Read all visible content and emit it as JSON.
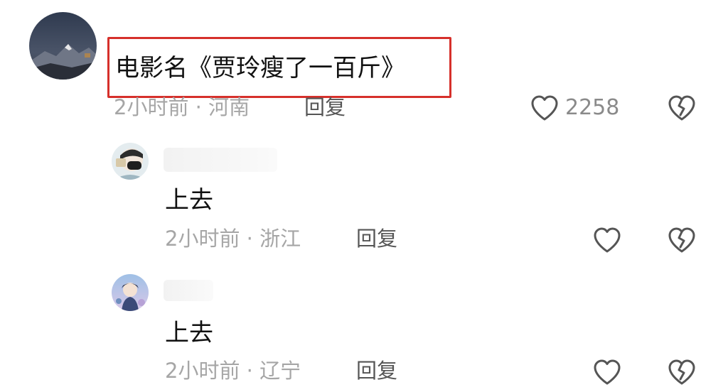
{
  "main_comment": {
    "text": "电影名《贾玲瘦了一百斤》",
    "time": "2小时前",
    "location": "河南",
    "separator": "·",
    "reply_label": "回复",
    "like_count": "2258",
    "highlight_color": "#d6302b"
  },
  "replies": [
    {
      "text": "上去",
      "time": "2小时前",
      "location": "浙江",
      "separator": "·",
      "reply_label": "回复"
    },
    {
      "text": "上去",
      "time": "2小时前",
      "location": "辽宁",
      "separator": "·",
      "reply_label": "回复"
    }
  ],
  "icons": {
    "like": "heart-outline-icon",
    "dislike": "broken-heart-icon"
  },
  "colors": {
    "text": "#111111",
    "meta": "#a6a6a6",
    "icon": "#555555"
  }
}
